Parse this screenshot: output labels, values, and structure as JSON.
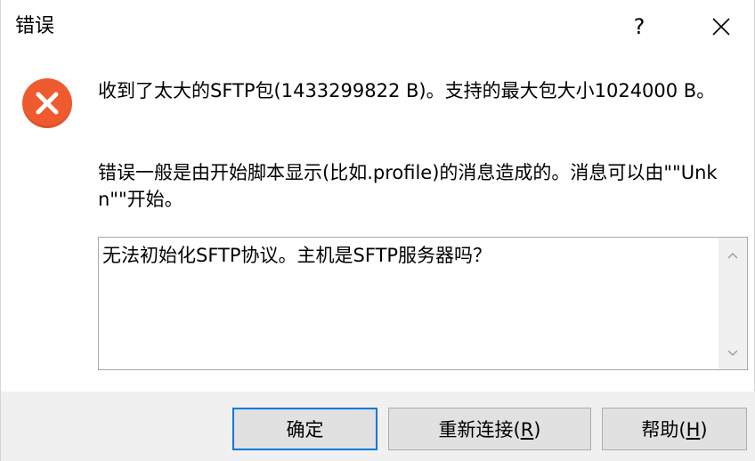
{
  "window": {
    "title": "错误",
    "help_glyph": "?",
    "close_glyph": "✕"
  },
  "icon": {
    "name": "error-icon",
    "color": "#ef5b2e"
  },
  "message": {
    "line1": "收到了太大的SFTP包(1433299822 B)。支持的最大包大小1024000 B。",
    "line2": "错误一般是由开始脚本显示(比如.profile)的消息造成的。消息可以由\"\"Unkn\"\"开始。"
  },
  "details": {
    "text": "无法初始化SFTP协议。主机是SFTP服务器吗？"
  },
  "buttons": {
    "ok": "确定",
    "reconnect_prefix": "重新连接(",
    "reconnect_key": "R",
    "reconnect_suffix": ")",
    "help_prefix": "帮助(",
    "help_key": "H",
    "help_suffix": ")"
  },
  "colors": {
    "accent": "#0078d7",
    "button_bg": "#e1e1e1",
    "footer_bg": "#f0f0f0"
  }
}
